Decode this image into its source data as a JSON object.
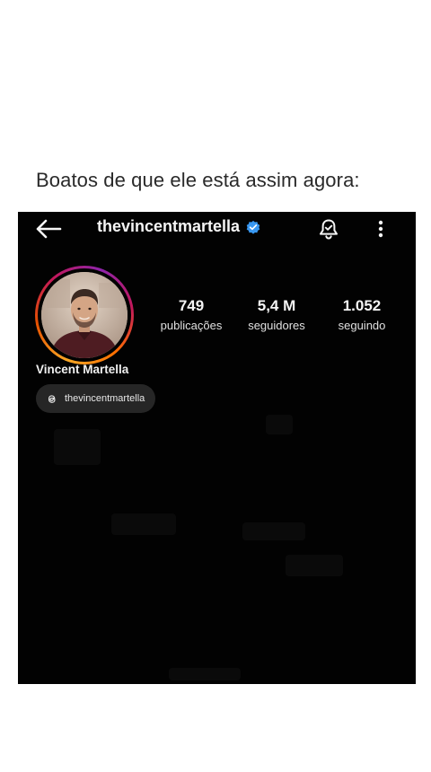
{
  "caption": "Boatos de que ele está assim agora:",
  "profile": {
    "handle": "thevincentmartella",
    "name": "Vincent Martella",
    "threads_handle": "thevincentmartella",
    "stats": [
      {
        "value": "749",
        "label": "publicações"
      },
      {
        "value": "5,4 M",
        "label": "seguidores"
      },
      {
        "value": "1.052",
        "label": "seguindo"
      }
    ]
  },
  "icons": {
    "back": "arrow-left-icon",
    "verified": "verified-badge-icon",
    "notifications": "bell-icon",
    "more": "more-vertical-icon",
    "threads": "threads-icon"
  },
  "colors": {
    "background": "#020202",
    "verified": "#3897f0",
    "chip": "#262626"
  }
}
